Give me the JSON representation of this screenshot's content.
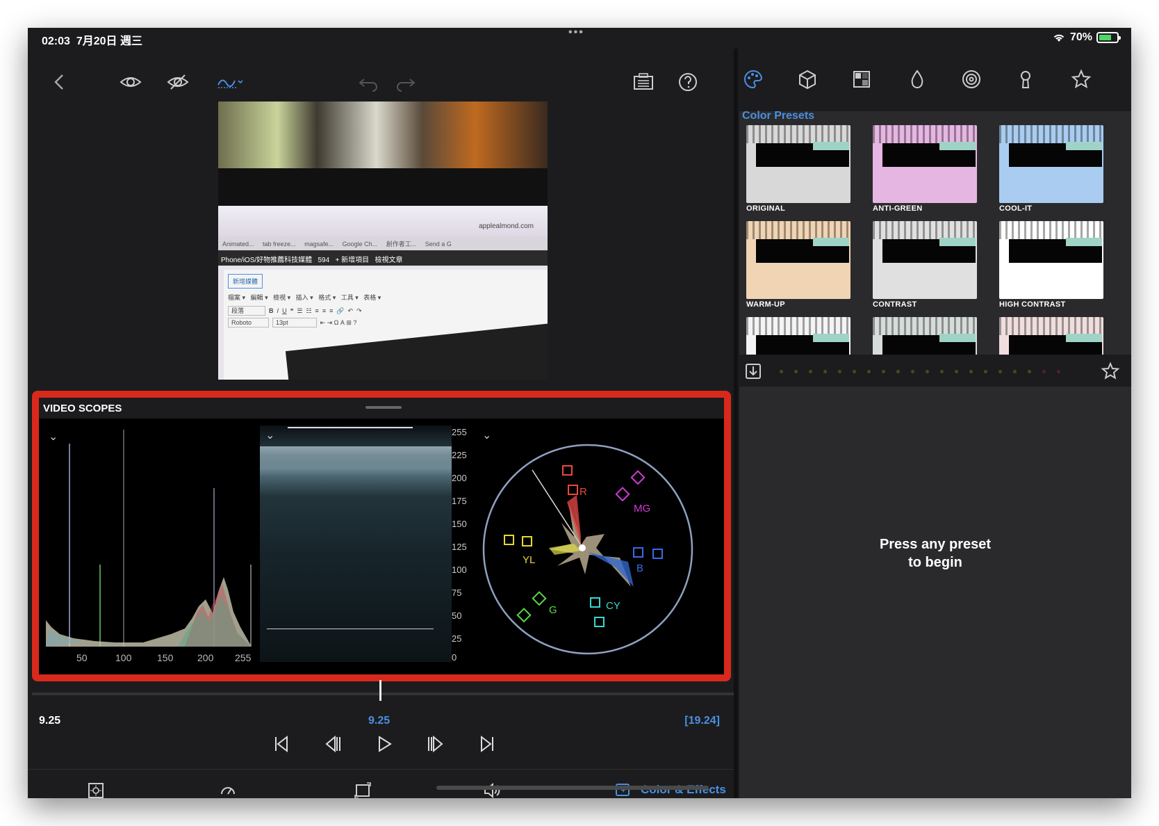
{
  "status": {
    "time": "02:03",
    "date": "7月20日 週三",
    "battery": "70%"
  },
  "toolbar": {
    "back_icon": "chevron-left-icon",
    "icons": [
      "eye-icon",
      "eye-slash-icon",
      "scopes-dropdown-icon",
      "undo-icon",
      "redo-icon",
      "clipboard-icon",
      "help-icon"
    ]
  },
  "preview": {
    "url": "applealmond.com",
    "tabs": [
      "Animated...",
      "tab freeze...",
      "magsafe...",
      "Google Ch...",
      "創作者工...",
      "Send a G"
    ],
    "navbar_text": "Phone/iOS/好物推薦科技媒體",
    "navbar_count": "594",
    "navbar_new": "+ 新增項目",
    "navbar_view": "檢視文章",
    "add_media": "新增媒體",
    "menu_items": [
      "檔案",
      "編輯",
      "檢視",
      "插入",
      "格式",
      "工具",
      "表格"
    ],
    "format_paragraph": "段落",
    "format_font": "Roboto",
    "format_size": "13pt"
  },
  "scopes": {
    "title": "VIDEO SCOPES",
    "histogram": {
      "x_ticks": [
        "50",
        "100",
        "150",
        "200",
        "255"
      ]
    },
    "waveform": {
      "y_ticks": [
        "255",
        "225",
        "200",
        "175",
        "150",
        "125",
        "100",
        "75",
        "50",
        "25",
        "0"
      ]
    },
    "vectorscope": {
      "labels": [
        "R",
        "MG",
        "YL",
        "B",
        "G",
        "CY"
      ],
      "colors": {
        "R": "#e84a3a",
        "MG": "#d33ad8",
        "YL": "#e8d63a",
        "B": "#3a6ae8",
        "G": "#5ad84a",
        "CY": "#3ad8d0"
      }
    }
  },
  "timeline": {
    "current_left": "9.25",
    "current_center": "9.25",
    "duration": "[19.24]"
  },
  "transport": [
    "skip-to-start-icon",
    "step-back-icon",
    "play-icon",
    "step-forward-icon",
    "skip-to-end-icon"
  ],
  "bottom_bar": {
    "icons": [
      "crop-icon",
      "speed-icon",
      "transform-icon",
      "audio-icon"
    ],
    "active_label": "Color & Effects"
  },
  "right_panel": {
    "tool_icons": [
      "palette-icon",
      "cube-icon",
      "lut-icon",
      "drop-icon",
      "vignette-icon",
      "keyhole-icon",
      "star-icon"
    ],
    "section_title": "Color Presets",
    "presets": [
      {
        "label": "ORIGINAL",
        "tint": "#d8d8d8"
      },
      {
        "label": "ANTI-GREEN",
        "tint": "#e6b6e2"
      },
      {
        "label": "COOL-IT",
        "tint": "#a9ccf0"
      },
      {
        "label": "WARM-UP",
        "tint": "#f0d4b4"
      },
      {
        "label": "CONTRAST",
        "tint": "#e0e0e0"
      },
      {
        "label": "HIGH CONTRAST",
        "tint": "#ffffff"
      },
      {
        "label": "",
        "tint": "#f4f4f4"
      },
      {
        "label": "",
        "tint": "#d6dcd9"
      },
      {
        "label": "",
        "tint": "#f0dede"
      }
    ],
    "prompt_line1": "Press any preset",
    "prompt_line2": "to begin"
  },
  "accent": "#4a90e2",
  "highlight_border": "#d9291c"
}
